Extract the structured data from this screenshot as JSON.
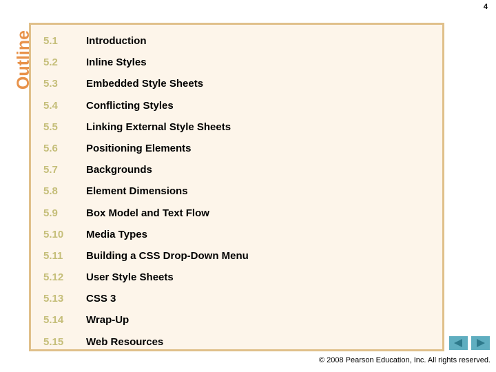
{
  "slide": {
    "page_number": "4",
    "outline_label": "Outline",
    "colors": {
      "panel_background": "#FDF5EA",
      "panel_border": "#E0C08A",
      "outline_label": "#E8924A",
      "section_number": "#C5BE79",
      "section_title": "#000000",
      "nav_button_background": "#5FAEC0",
      "nav_button_arrow": "#2E7A8C",
      "page_background": "#FFFFFF"
    }
  },
  "outline": {
    "items": [
      {
        "number": "5.1",
        "title": "Introduction"
      },
      {
        "number": "5.2",
        "title": "Inline Styles"
      },
      {
        "number": "5.3",
        "title": "Embedded Style Sheets"
      },
      {
        "number": "5.4",
        "title": "Conflicting Styles"
      },
      {
        "number": "5.5",
        "title": "Linking External Style Sheets"
      },
      {
        "number": "5.6",
        "title": "Positioning Elements"
      },
      {
        "number": "5.7",
        "title": "Backgrounds"
      },
      {
        "number": "5.8",
        "title": "Element Dimensions"
      },
      {
        "number": "5.9",
        "title": "Box Model and Text Flow"
      },
      {
        "number": "5.10",
        "title": "Media Types"
      },
      {
        "number": "5.11",
        "title": "Building a CSS Drop-Down Menu"
      },
      {
        "number": "5.12",
        "title": "User Style Sheets"
      },
      {
        "number": "5.13",
        "title": "CSS 3"
      },
      {
        "number": "5.14",
        "title": "Wrap-Up"
      },
      {
        "number": "5.15",
        "title": "Web Resources"
      }
    ]
  },
  "navigation": {
    "previous_label": "previous-slide",
    "next_label": "next-slide"
  },
  "footer": {
    "copyright": "© 2008 Pearson Education, Inc.  All rights reserved."
  }
}
